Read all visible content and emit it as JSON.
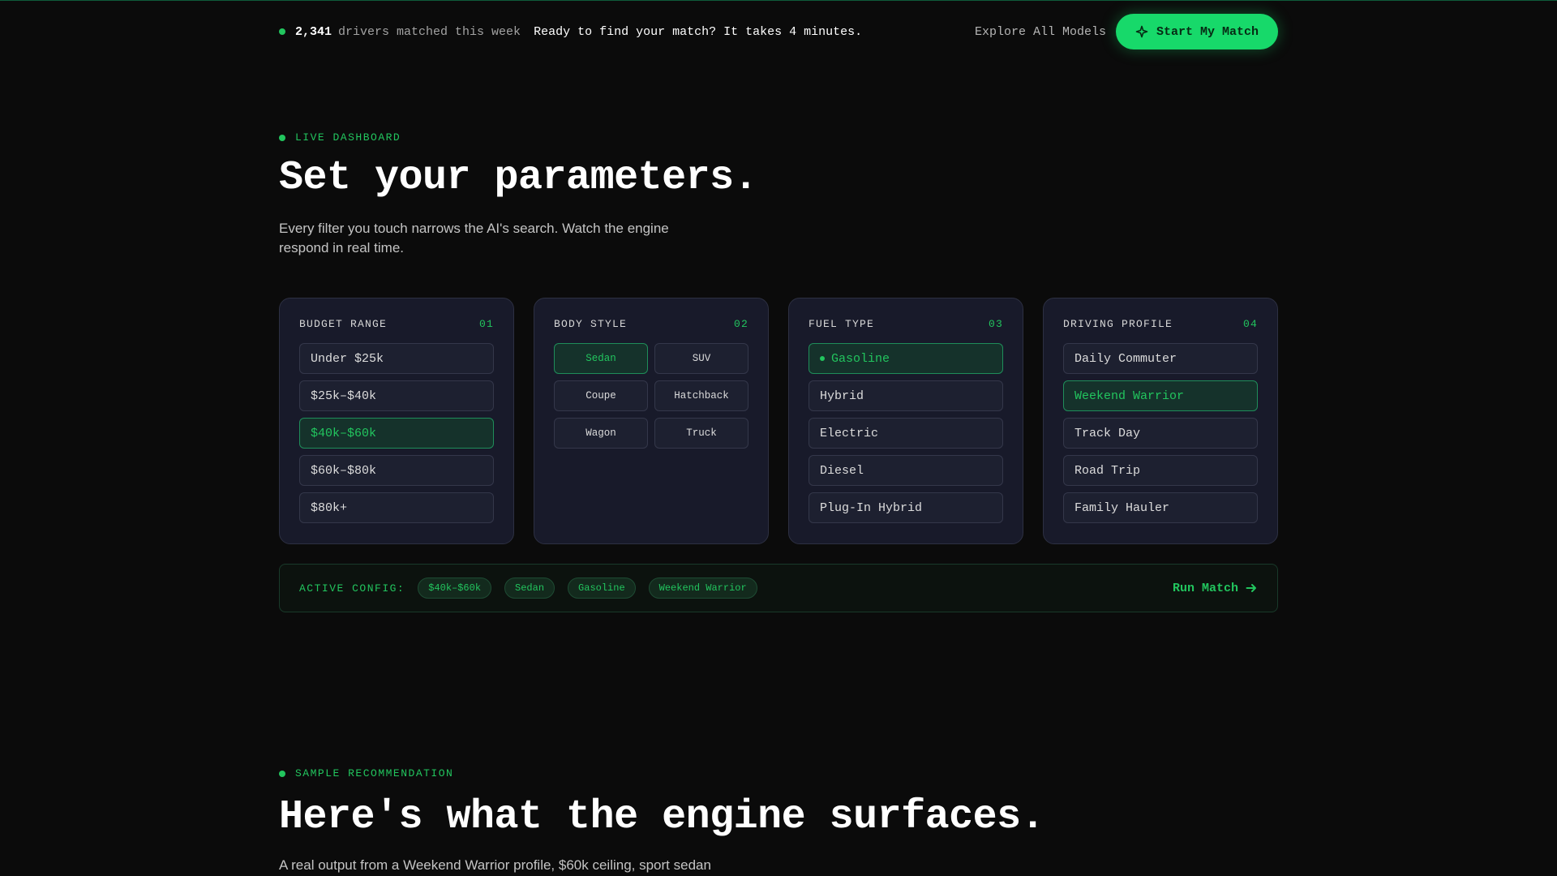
{
  "topbar": {
    "count": "2,341",
    "count_suffix": "drivers matched this week",
    "ready": "Ready to find your match? It takes 4 minutes.",
    "explore": "Explore All Models",
    "start": "Start My Match"
  },
  "params": {
    "eyebrow": "LIVE DASHBOARD",
    "title": "Set your parameters.",
    "subtitle_1": "Every filter you touch narrows the AI's search. Watch the engine",
    "subtitle_2": "respond in real time."
  },
  "cards": {
    "budget": {
      "title": "BUDGET RANGE",
      "num": "01",
      "options": [
        "Under $25k",
        "$25k–$40k",
        "$40k–$60k",
        "$60k–$80k",
        "$80k+"
      ],
      "selected": "$40k–$60k"
    },
    "body": {
      "title": "BODY STYLE",
      "num": "02",
      "options": [
        "Sedan",
        "SUV",
        "Coupe",
        "Hatchback",
        "Wagon",
        "Truck"
      ],
      "selected": "Sedan"
    },
    "fuel": {
      "title": "FUEL TYPE",
      "num": "03",
      "options": [
        "Gasoline",
        "Hybrid",
        "Electric",
        "Diesel",
        "Plug-In Hybrid"
      ],
      "selected": "Gasoline"
    },
    "profile": {
      "title": "DRIVING PROFILE",
      "num": "04",
      "options": [
        "Daily Commuter",
        "Weekend Warrior",
        "Track Day",
        "Road Trip",
        "Family Hauler"
      ],
      "selected": "Weekend Warrior"
    }
  },
  "config": {
    "label": "ACTIVE CONFIG:",
    "chips": [
      "$40k–$60k",
      "Sedan",
      "Gasoline",
      "Weekend Warrior"
    ],
    "run": "Run Match"
  },
  "sample": {
    "eyebrow": "SAMPLE RECOMMENDATION",
    "title": "Here's what the engine surfaces.",
    "subtitle": "A real output from a Weekend Warrior profile, $60k ceiling, sport sedan"
  },
  "colors": {
    "accent": "#22c55e",
    "button": "#17d96a",
    "background": "#0b0b0b",
    "card": "#181a2a"
  }
}
